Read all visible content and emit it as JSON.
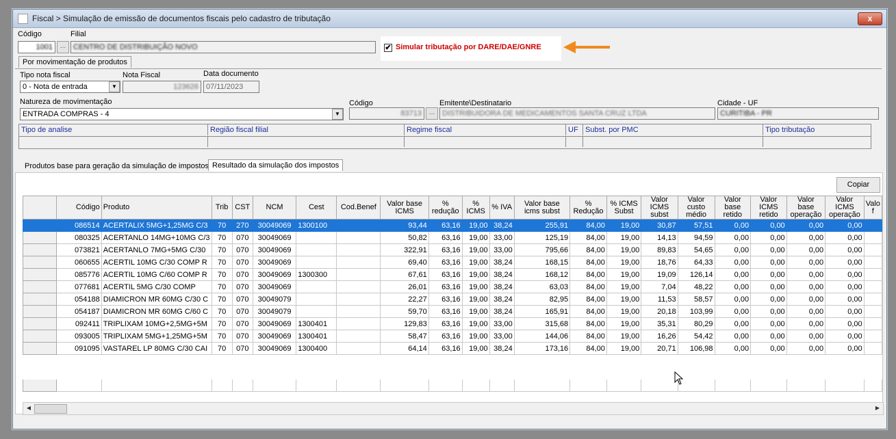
{
  "window": {
    "title": "Fiscal > Simulação de emissão de documentos fiscais pelo cadastro de tributação",
    "close_label": "x"
  },
  "header": {
    "codigo_label": "Código",
    "codigo_value": "1001",
    "filial_label": "Filial",
    "filial_value": "CENTRO DE DISTRIBUIÇÃO NOVO",
    "simular_label": "Simular tributação por DARE/DAE/GNRE",
    "simular_checked": "✔"
  },
  "main_tab": "Por movimentação de produtos",
  "form": {
    "tipo_nota_label": "Tipo nota fiscal",
    "tipo_nota_value": "0 - Nota de entrada",
    "nota_fiscal_label": "Nota Fiscal",
    "nota_fiscal_value": "123626",
    "data_label": "Data documento",
    "data_value": "07/11/2023",
    "natureza_label": "Natureza de movimentação",
    "natureza_value": "ENTRADA COMPRAS - 4",
    "codigo2_label": "Código",
    "codigo2_value": "83713",
    "emitente_label": "Emitente\\Destinatario",
    "emitente_value": "DISTRIBUIDORA DE MEDICAMENTOS SANTA CRUZ LTDA",
    "cidade_label": "Cidade - UF",
    "cidade_value": "CURITIBA - PR"
  },
  "info_grid": {
    "headers": [
      "Tipo de analise",
      "Região fiscal filial",
      "Regime fiscal",
      "UF",
      "Subst. por PMC",
      "Tipo tributação"
    ]
  },
  "sub_tabs": [
    "Produtos base para geração da simulação de impostos",
    "Resultado da simulação dos impostos"
  ],
  "copy_button": "Copiar",
  "table": {
    "columns": [
      "Código",
      "Produto",
      "Trib",
      "CST",
      "NCM",
      "Cest",
      "Cod.Benef",
      "Valor base ICMS",
      "% redução",
      "% ICMS",
      "% IVA",
      "Valor base icms subst",
      "% Redução",
      "% ICMS Subst",
      "Valor ICMS subst",
      "Valor custo médio",
      "Valor base retido",
      "Valor ICMS retido",
      "Valor base operação",
      "Valor ICMS operação",
      "Valo f"
    ],
    "rows": [
      [
        "086514",
        "ACERTALIX 5MG+1,25MG C/3",
        "70",
        "270",
        "30049069",
        "1300100",
        "",
        "93,44",
        "63,16",
        "19,00",
        "38,24",
        "255,91",
        "84,00",
        "19,00",
        "30,87",
        "57,51",
        "0,00",
        "0,00",
        "0,00",
        "0,00",
        ""
      ],
      [
        "080325",
        "ACERTANLO 14MG+10MG C/3",
        "70",
        "070",
        "30049069",
        "",
        "",
        "50,82",
        "63,16",
        "19,00",
        "33,00",
        "125,19",
        "84,00",
        "19,00",
        "14,13",
        "94,59",
        "0,00",
        "0,00",
        "0,00",
        "0,00",
        ""
      ],
      [
        "073821",
        "ACERTANLO 7MG+5MG C/30",
        "70",
        "070",
        "30049069",
        "",
        "",
        "322,91",
        "63,16",
        "19,00",
        "33,00",
        "795,66",
        "84,00",
        "19,00",
        "89,83",
        "54,65",
        "0,00",
        "0,00",
        "0,00",
        "0,00",
        ""
      ],
      [
        "060655",
        "ACERTIL 10MG C/30 COMP R",
        "70",
        "070",
        "30049069",
        "",
        "",
        "69,40",
        "63,16",
        "19,00",
        "38,24",
        "168,15",
        "84,00",
        "19,00",
        "18,76",
        "64,33",
        "0,00",
        "0,00",
        "0,00",
        "0,00",
        ""
      ],
      [
        "085776",
        "ACERTIL 10MG C/60 COMP R",
        "70",
        "070",
        "30049069",
        "1300300",
        "",
        "67,61",
        "63,16",
        "19,00",
        "38,24",
        "168,12",
        "84,00",
        "19,00",
        "19,09",
        "126,14",
        "0,00",
        "0,00",
        "0,00",
        "0,00",
        ""
      ],
      [
        "077681",
        "ACERTIL 5MG C/30 COMP",
        "70",
        "070",
        "30049069",
        "",
        "",
        "26,01",
        "63,16",
        "19,00",
        "38,24",
        "63,03",
        "84,00",
        "19,00",
        "7,04",
        "48,22",
        "0,00",
        "0,00",
        "0,00",
        "0,00",
        ""
      ],
      [
        "054188",
        "DIAMICRON MR 60MG C/30 C",
        "70",
        "070",
        "30049079",
        "",
        "",
        "22,27",
        "63,16",
        "19,00",
        "38,24",
        "82,95",
        "84,00",
        "19,00",
        "11,53",
        "58,57",
        "0,00",
        "0,00",
        "0,00",
        "0,00",
        ""
      ],
      [
        "054187",
        "DIAMICRON MR 60MG C/60 C",
        "70",
        "070",
        "30049079",
        "",
        "",
        "59,70",
        "63,16",
        "19,00",
        "38,24",
        "165,91",
        "84,00",
        "19,00",
        "20,18",
        "103,99",
        "0,00",
        "0,00",
        "0,00",
        "0,00",
        ""
      ],
      [
        "092411",
        "TRIPLIXAM 10MG+2,5MG+5M",
        "70",
        "070",
        "30049069",
        "1300401",
        "",
        "129,83",
        "63,16",
        "19,00",
        "33,00",
        "315,68",
        "84,00",
        "19,00",
        "35,31",
        "80,29",
        "0,00",
        "0,00",
        "0,00",
        "0,00",
        ""
      ],
      [
        "093005",
        "TRIPLIXAM 5MG+1,25MG+5M",
        "70",
        "070",
        "30049069",
        "1300401",
        "",
        "58,47",
        "63,16",
        "19,00",
        "33,00",
        "144,06",
        "84,00",
        "19,00",
        "16,26",
        "54,42",
        "0,00",
        "0,00",
        "0,00",
        "0,00",
        ""
      ],
      [
        "091095",
        "VASTAREL LP 80MG C/30 CAI",
        "70",
        "070",
        "30049069",
        "1300400",
        "",
        "64,14",
        "63,16",
        "19,00",
        "38,24",
        "173,16",
        "84,00",
        "19,00",
        "20,71",
        "106,98",
        "0,00",
        "0,00",
        "0,00",
        "0,00",
        ""
      ]
    ]
  },
  "colors": {
    "accent_arrow": "#f08a1c",
    "selection": "#1e76d6",
    "checkbox_label": "#cc0000"
  }
}
